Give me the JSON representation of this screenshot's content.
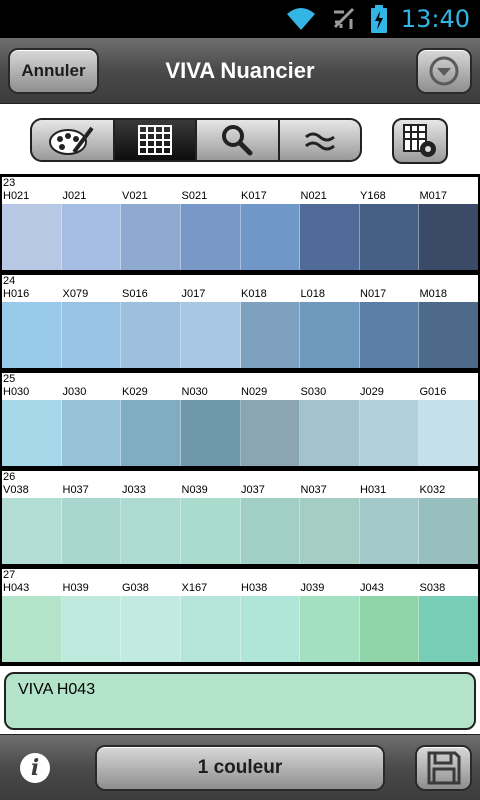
{
  "status_bar": {
    "time": "13:40",
    "icons": [
      "wifi-icon",
      "airplane-icon",
      "battery-charging-icon"
    ]
  },
  "header": {
    "cancel_label": "Annuler",
    "title": "VIVA Nuancier",
    "menu_icon": "chevron-down-circle-icon"
  },
  "toolbar": {
    "tabs": [
      {
        "icon": "palette-brush-icon",
        "active": false
      },
      {
        "icon": "swatch-grid-icon",
        "active": true
      },
      {
        "icon": "search-icon",
        "active": false
      },
      {
        "icon": "approx-equal-icon",
        "active": false
      }
    ],
    "settings_icon": "swatches-gear-icon"
  },
  "groups": [
    {
      "number": "23",
      "codes": [
        "H021",
        "J021",
        "V021",
        "S021",
        "K017",
        "N021",
        "Y168",
        "M017"
      ],
      "colors": [
        "#b6c8e4",
        "#a5bde3",
        "#8eaad0",
        "#7899c8",
        "#6f98c8",
        "#506b97",
        "#465f85",
        "#3b4a66"
      ]
    },
    {
      "number": "24",
      "codes": [
        "H016",
        "X079",
        "S016",
        "J017",
        "K018",
        "L018",
        "N017",
        "M018"
      ],
      "colors": [
        "#99c9eb",
        "#98c3e4",
        "#9dc0df",
        "#a7c7e2",
        "#7ea1bf",
        "#6f98bd",
        "#5a7ea6",
        "#4e6a8b"
      ]
    },
    {
      "number": "25",
      "codes": [
        "H030",
        "J030",
        "K029",
        "N030",
        "N029",
        "S030",
        "J029",
        "G016"
      ],
      "colors": [
        "#a6d8e9",
        "#96c1d6",
        "#80adc2",
        "#6f98ac",
        "#8ca5b5",
        "#a3c2d0",
        "#b1d0db",
        "#c5e0ea"
      ]
    },
    {
      "number": "26",
      "codes": [
        "V038",
        "H037",
        "J033",
        "N039",
        "J037",
        "N037",
        "H031",
        "K032"
      ],
      "colors": [
        "#b2ddd5",
        "#a9d7cf",
        "#aedbd1",
        "#aadcce",
        "#a1cfc6",
        "#a4cdc4",
        "#a3c8ca",
        "#97bfbd"
      ]
    },
    {
      "number": "27",
      "codes": [
        "H043",
        "H039",
        "G038",
        "X167",
        "H038",
        "J039",
        "J043",
        "S038"
      ],
      "colors": [
        "#b3e4c9",
        "#bdeadd",
        "#c1eae0",
        "#b5e5d8",
        "#b0e6d7",
        "#a3e0c2",
        "#8fd4a8",
        "#77cdb5"
      ]
    }
  ],
  "selection": {
    "text": "VIVA H043",
    "color": "#b3e4c9"
  },
  "footer": {
    "info_label": "i",
    "count_label": "1 couleur",
    "save_icon": "save-icon"
  }
}
